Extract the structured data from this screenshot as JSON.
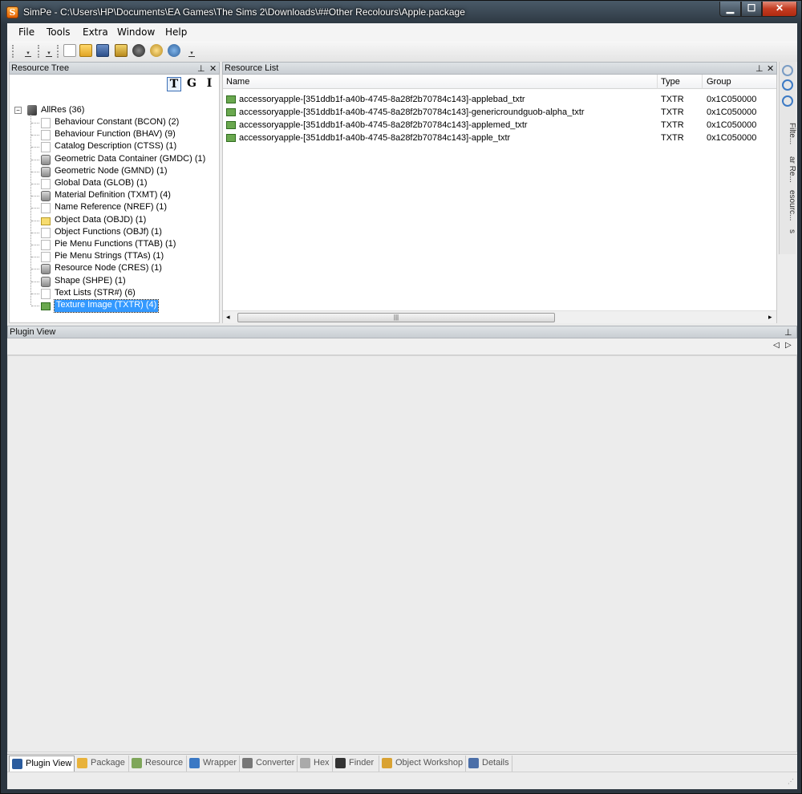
{
  "window": {
    "title": "SimPe - C:\\Users\\HP\\Documents\\EA Games\\The Sims 2\\Downloads\\##Other Recolours\\Apple.package",
    "app_icon_letter": "S",
    "min_glyph": "▁",
    "max_glyph": "☐",
    "close_glyph": "✕"
  },
  "menu": {
    "items": [
      "File",
      "Tools",
      "Extra",
      "Window",
      "Help"
    ]
  },
  "toolbar": {
    "icons": [
      "new-icon",
      "open-icon",
      "save-icon",
      "save-as-icon",
      "close-icon",
      "users-icon",
      "search-delete-icon"
    ]
  },
  "resource_tree": {
    "title": "Resource Tree",
    "pin_glyph": "⊥",
    "close_glyph": "✕",
    "modes": [
      "T",
      "G",
      "I"
    ],
    "root": "AllRes (36)",
    "expander": "−",
    "items": [
      {
        "label": "Behaviour Constant (BCON) (2)",
        "icon": "file"
      },
      {
        "label": "Behaviour Function (BHAV) (9)",
        "icon": "file"
      },
      {
        "label": "Catalog Description (CTSS) (1)",
        "icon": "file"
      },
      {
        "label": "Geometric Data Container (GMDC) (1)",
        "icon": "db"
      },
      {
        "label": "Geometric Node (GMND) (1)",
        "icon": "db"
      },
      {
        "label": "Global Data (GLOB) (1)",
        "icon": "file"
      },
      {
        "label": "Material Definition (TXMT) (4)",
        "icon": "db"
      },
      {
        "label": "Name Reference (NREF) (1)",
        "icon": "file"
      },
      {
        "label": "Object Data (OBJD) (1)",
        "icon": "folder"
      },
      {
        "label": "Object Functions (OBJf) (1)",
        "icon": "file"
      },
      {
        "label": "Pie Menu Functions (TTAB) (1)",
        "icon": "file"
      },
      {
        "label": "Pie Menu Strings (TTAs) (1)",
        "icon": "file"
      },
      {
        "label": "Resource Node (CRES) (1)",
        "icon": "db"
      },
      {
        "label": "Shape (SHPE) (1)",
        "icon": "db"
      },
      {
        "label": "Text Lists (STR#) (6)",
        "icon": "file"
      },
      {
        "label": "Texture Image (TXTR) (4)",
        "icon": "img",
        "selected": true
      }
    ]
  },
  "resource_list": {
    "title": "Resource List",
    "pin_glyph": "⊥",
    "close_glyph": "✕",
    "columns": [
      "Name",
      "Type",
      "Group"
    ],
    "rows": [
      {
        "name": "accessoryapple-[351ddb1f-a40b-4745-8a28f2b70784c143]-applebad_txtr",
        "type": "TXTR",
        "group": "0x1C050000"
      },
      {
        "name": "accessoryapple-[351ddb1f-a40b-4745-8a28f2b70784c143]-genericroundguob-alpha_txtr",
        "type": "TXTR",
        "group": "0x1C050000"
      },
      {
        "name": "accessoryapple-[351ddb1f-a40b-4745-8a28f2b70784c143]-applemed_txtr",
        "type": "TXTR",
        "group": "0x1C050000"
      },
      {
        "name": "accessoryapple-[351ddb1f-a40b-4745-8a28f2b70784c143]-apple_txtr",
        "type": "TXTR",
        "group": "0x1C050000"
      }
    ],
    "scroll_left": "◂",
    "scroll_right": "▸",
    "thumb_grip": "|||"
  },
  "side_strip": {
    "tabs": [
      "Filte...",
      "ar Re...",
      "esourc...",
      "s"
    ]
  },
  "plugin_view": {
    "title": "Plugin View",
    "pin_glyph": "⊥",
    "nav_left": "◁",
    "nav_right": "▷"
  },
  "bottom_tabs": [
    {
      "label": "Plugin View",
      "icon": "plugin-view-icon",
      "color": "#2b5c9e"
    },
    {
      "label": "Package",
      "icon": "package-icon",
      "color": "#e8b23a"
    },
    {
      "label": "Resource",
      "icon": "resource-icon",
      "color": "#7fa65a"
    },
    {
      "label": "Wrapper",
      "icon": "wrapper-icon",
      "color": "#3a78c4"
    },
    {
      "label": "Converter",
      "icon": "converter-icon",
      "color": "#777777"
    },
    {
      "label": "Hex",
      "icon": "hex-icon",
      "color": "#aaaaaa"
    },
    {
      "label": "Finder",
      "icon": "finder-icon",
      "color": "#333333"
    },
    {
      "label": "Object Workshop",
      "icon": "object-workshop-icon",
      "color": "#d9a232"
    },
    {
      "label": "Details",
      "icon": "details-icon",
      "color": "#4c6fa8"
    }
  ],
  "statusbar": {
    "grip": "⋰"
  }
}
